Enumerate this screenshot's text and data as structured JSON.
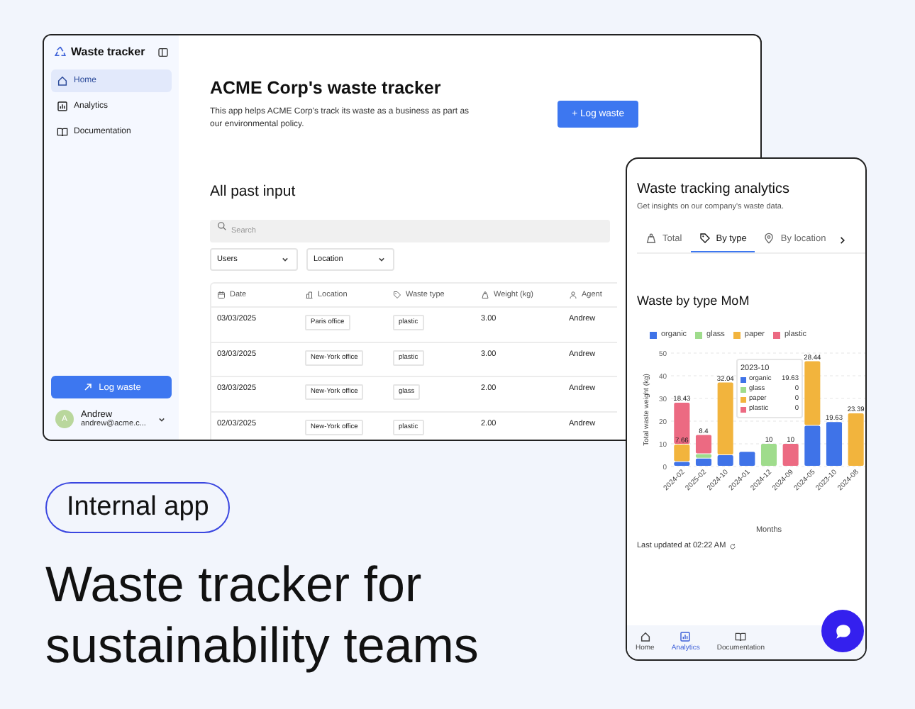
{
  "desktop_app": {
    "sidebar": {
      "app_name": "Waste tracker",
      "items": [
        {
          "label": "Home",
          "selected": true
        },
        {
          "label": "Analytics",
          "selected": false
        },
        {
          "label": "Documentation",
          "selected": false
        }
      ],
      "action_button": "Log waste",
      "user": {
        "initial": "A",
        "name": "Andrew",
        "email": "andrew@acme.c..."
      }
    },
    "title": "ACME Corp's waste tracker",
    "description": "This app helps ACME Corp's track its waste as a business as part as our environmental policy.",
    "log_button": "+ Log waste",
    "section_title": "All past input",
    "search": {
      "placeholder": "Search"
    },
    "filters": [
      "Users",
      "Location"
    ],
    "table": {
      "columns": [
        "Date",
        "Location",
        "Waste type",
        "Weight (kg)",
        "Agent"
      ],
      "rows": [
        [
          "03/03/2025",
          "Paris office",
          "plastic",
          "3.00",
          "Andrew"
        ],
        [
          "03/03/2025",
          "New-York office",
          "plastic",
          "3.00",
          "Andrew"
        ],
        [
          "03/03/2025",
          "New-York office",
          "glass",
          "2.00",
          "Andrew"
        ],
        [
          "02/03/2025",
          "New-York office",
          "plastic",
          "2.00",
          "Andrew"
        ]
      ]
    }
  },
  "mobile_app": {
    "title": "Waste tracking analytics",
    "subtitle": "Get insights on our company's waste data.",
    "tabs": [
      {
        "label": "Total",
        "selected": false
      },
      {
        "label": "By type",
        "selected": true
      },
      {
        "label": "By location",
        "selected": false
      }
    ],
    "chart_title": "Waste by type MoM",
    "chart_data": {
      "type": "bar",
      "stacked": true,
      "grid": true,
      "legend": true,
      "xlabel": "Months",
      "ylabel": "Total waste weight (kg)",
      "categories": [
        "2024-02",
        "2025-02",
        "2024-10",
        "2024-01",
        "2024-12",
        "2024-09",
        "2024-05",
        "2023-10",
        "2024-08"
      ],
      "series": [
        {
          "name": "organic",
          "color": "#3f73e8",
          "values": [
            2,
            3.5,
            5,
            6.5,
            0,
            0,
            18,
            19.6,
            0
          ]
        },
        {
          "name": "glass",
          "color": "#9fdc8c",
          "values": [
            0,
            2,
            0,
            0,
            10,
            0,
            0,
            0,
            0
          ]
        },
        {
          "name": "paper",
          "color": "#f2b43d",
          "values": [
            7.7,
            0,
            32,
            0,
            0,
            0,
            28.4,
            0,
            23.4
          ]
        },
        {
          "name": "plastic",
          "color": "#ec6a82",
          "values": [
            18.4,
            8.4,
            0,
            0,
            0,
            10,
            0,
            0,
            0
          ]
        }
      ],
      "ylim": [
        0,
        50
      ],
      "yticks": [
        0,
        10,
        20,
        30,
        40,
        50
      ],
      "annotations": [
        {
          "x": "2024-02",
          "y": 28.1,
          "text": "18.43"
        },
        {
          "x": "2024-02",
          "y": 9.7,
          "text": "7.66"
        },
        {
          "x": "2025-02",
          "y": 13.9,
          "text": "8.4"
        },
        {
          "x": "2024-10",
          "y": 37,
          "text": "32.04"
        },
        {
          "x": "2024-12",
          "y": 10,
          "text": "10"
        },
        {
          "x": "2024-09",
          "y": 10,
          "text": "10"
        },
        {
          "x": "2024-05",
          "y": 46.4,
          "text": "28.44"
        },
        {
          "x": "2023-10",
          "y": 19.6,
          "text": "19.63"
        },
        {
          "x": "2024-08",
          "y": 23.4,
          "text": "23.39"
        }
      ]
    },
    "chart_tooltip": {
      "title": "2023-10",
      "rows": [
        {
          "name": "organic",
          "value": "19.63",
          "color": "#3f73e8"
        },
        {
          "name": "glass",
          "value": "0",
          "color": "#9fdc8c"
        },
        {
          "name": "paper",
          "value": "0",
          "color": "#f2b43d"
        },
        {
          "name": "plastic",
          "value": "0",
          "color": "#ec6a82"
        }
      ]
    },
    "updated": "Last updated at 02:22 AM",
    "nav": [
      {
        "label": "Home",
        "selected": false
      },
      {
        "label": "Analytics",
        "selected": true
      },
      {
        "label": "Documentation",
        "selected": false
      }
    ]
  },
  "badge": "Internal app",
  "headline": "Waste tracker for sustainability teams"
}
